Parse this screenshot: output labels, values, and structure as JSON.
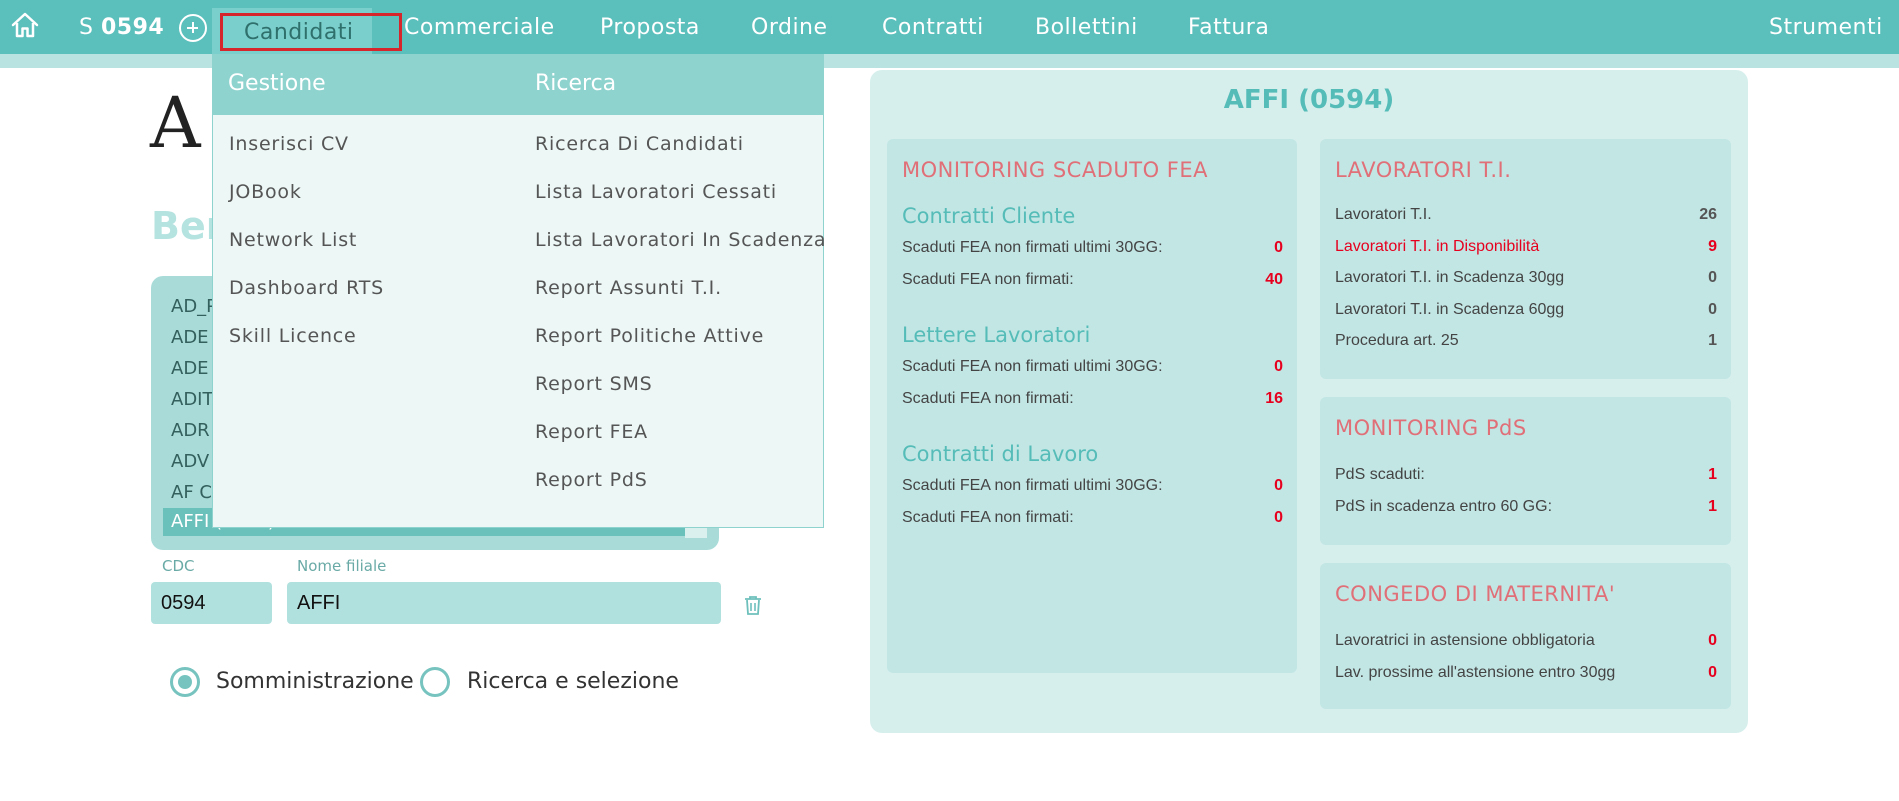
{
  "nav": {
    "branch_prefix": "S",
    "branch_code": "0594",
    "items": [
      "Candidati",
      "Commerciale",
      "Proposta",
      "Ordine",
      "Contratti",
      "Bollettini",
      "Fattura"
    ],
    "tools": "Strumenti"
  },
  "dropdown": {
    "gestione": {
      "header": "Gestione",
      "items": [
        "Inserisci CV",
        "JOBook",
        "Network List",
        "Dashboard RTS",
        "Skill Licence"
      ]
    },
    "ricerca": {
      "header": "Ricerca",
      "items": [
        "Ricerca Di Candidati",
        "Lista Lavoratori Cessati",
        "Lista Lavoratori In Scadenza",
        "Report Assunti T.I.",
        "Report Politiche Attive",
        "Report SMS",
        "Report FEA",
        "Report PdS"
      ]
    }
  },
  "left": {
    "welcome_partial": "Ben",
    "list_items": [
      "AD_P",
      "ADE",
      "ADE",
      "ADIT",
      "ADR",
      "ADV",
      "AF C",
      "AFFI (0594)"
    ],
    "cdc_label": "CDC",
    "cdc_value": "0594",
    "filiale_label": "Nome filiale",
    "filiale_value": "AFFI",
    "radio_1": "Somministrazione",
    "radio_2": "Ricerca e selezione"
  },
  "dashboard": {
    "title": "AFFI (0594)",
    "fea": {
      "title": "MONITORING SCADUTO FEA",
      "groups": [
        {
          "name": "Contratti Cliente",
          "rows": [
            {
              "label": "Scaduti FEA non firmati ultimi 30GG:",
              "value": "0"
            },
            {
              "label": "Scaduti FEA non firmati:",
              "value": "40"
            }
          ]
        },
        {
          "name": "Lettere Lavoratori",
          "rows": [
            {
              "label": "Scaduti FEA non firmati ultimi 30GG:",
              "value": "0"
            },
            {
              "label": "Scaduti FEA non firmati:",
              "value": "16"
            }
          ]
        },
        {
          "name": "Contratti di Lavoro",
          "rows": [
            {
              "label": "Scaduti FEA non firmati ultimi 30GG:",
              "value": "0"
            },
            {
              "label": "Scaduti FEA non firmati:",
              "value": "0"
            }
          ]
        }
      ]
    },
    "lavoratori": {
      "title": "LAVORATORI T.I.",
      "rows": [
        {
          "label": "Lavoratori T.I.",
          "value": "26"
        },
        {
          "label": "Lavoratori T.I. in Disponibilità",
          "value": "9"
        },
        {
          "label": "Lavoratori T.I. in Scadenza 30gg",
          "value": "0"
        },
        {
          "label": "Lavoratori T.I. in Scadenza 60gg",
          "value": "0"
        },
        {
          "label": "Procedura art. 25",
          "value": "1"
        }
      ]
    },
    "pds": {
      "title": "MONITORING PdS",
      "rows": [
        {
          "label": "PdS scaduti:",
          "value": "1"
        },
        {
          "label": "PdS in scadenza entro 60 GG:",
          "value": "1"
        }
      ]
    },
    "maternita": {
      "title": "CONGEDO DI MATERNITA'",
      "rows": [
        {
          "label": "Lavoratrici in astensione obbligatoria",
          "value": "0"
        },
        {
          "label": "Lav. prossime all'astensione entro 30gg",
          "value": "0"
        }
      ]
    }
  },
  "colors": {
    "nav_bg": "#5bbfbc",
    "accent_red": "#e6001e",
    "card_title": "#e06f78",
    "teal_text": "#55bcb8"
  }
}
